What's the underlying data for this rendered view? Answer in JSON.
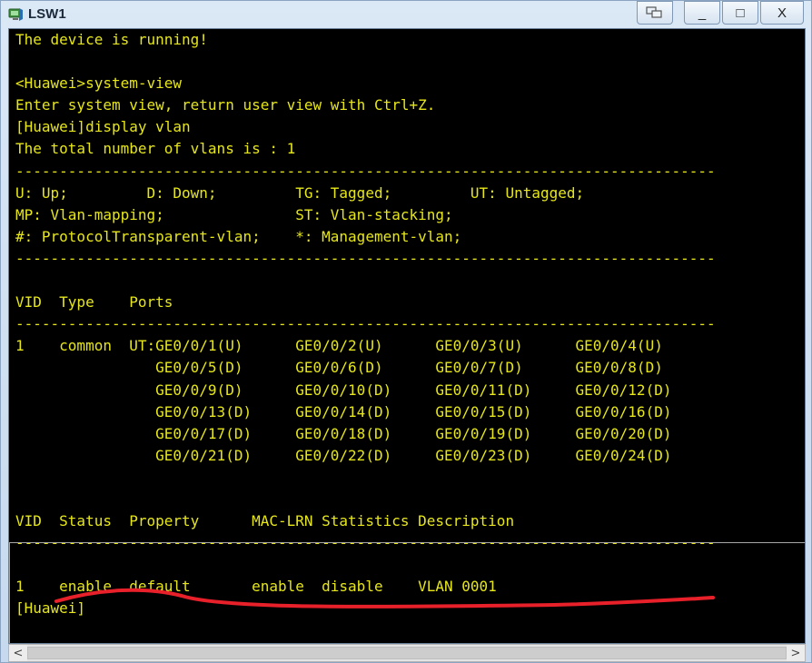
{
  "window": {
    "title": "LSW1",
    "icon": "computer-screen-icon",
    "controls": {
      "minimize": "_",
      "maximize": "□",
      "close": "X"
    }
  },
  "colors": {
    "terminal_bg": "#000000",
    "terminal_text": "#e6e61a",
    "annotation": "#e8202a"
  },
  "terminal": {
    "lines": [
      "The device is running!",
      "",
      "<Huawei>system-view",
      "Enter system view, return user view with Ctrl+Z.",
      "[Huawei]display vlan",
      "The total number of vlans is : 1",
      "--------------------------------------------------------------------------------",
      "U: Up;         D: Down;         TG: Tagged;         UT: Untagged;",
      "MP: Vlan-mapping;               ST: Vlan-stacking;",
      "#: ProtocolTransparent-vlan;    *: Management-vlan;",
      "--------------------------------------------------------------------------------",
      "",
      "VID  Type    Ports",
      "--------------------------------------------------------------------------------",
      "1    common  UT:GE0/0/1(U)      GE0/0/2(U)      GE0/0/3(U)      GE0/0/4(U)",
      "                GE0/0/5(D)      GE0/0/6(D)      GE0/0/7(D)      GE0/0/8(D)",
      "                GE0/0/9(D)      GE0/0/10(D)     GE0/0/11(D)     GE0/0/12(D)",
      "                GE0/0/13(D)     GE0/0/14(D)     GE0/0/15(D)     GE0/0/16(D)",
      "                GE0/0/17(D)     GE0/0/18(D)     GE0/0/19(D)     GE0/0/20(D)",
      "                GE0/0/21(D)     GE0/0/22(D)     GE0/0/23(D)     GE0/0/24(D)",
      "",
      "",
      "VID  Status  Property      MAC-LRN Statistics Description",
      "--------------------------------------------------------------------------------",
      "",
      "1    enable  default       enable  disable    VLAN 0001",
      "[Huawei]"
    ]
  },
  "scrollbar": {
    "left_arrow": "<",
    "right_arrow": ">"
  }
}
